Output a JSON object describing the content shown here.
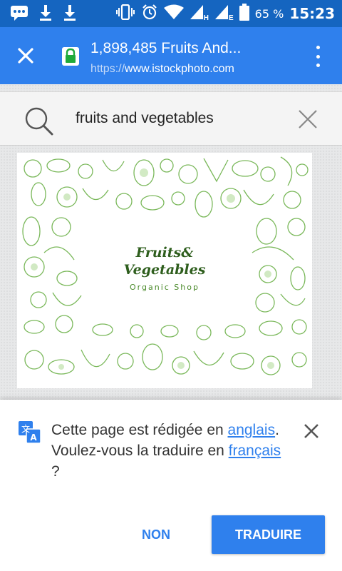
{
  "status_bar": {
    "icons": [
      "message-icon",
      "download-icon",
      "download-icon",
      "vibrate-icon",
      "alarm-icon",
      "wifi-icon",
      "signal-icon",
      "signal-icon",
      "battery-icon"
    ],
    "network_label_1": "H",
    "network_label_2": "E",
    "battery_percent": "65 %",
    "time": "15:23"
  },
  "toolbar": {
    "page_title": "1,898,485 Fruits And...",
    "url_protocol": "https://",
    "url_host": "www.istockphoto.com"
  },
  "search": {
    "query": "fruits and vegetables"
  },
  "image": {
    "logo_line1": "Fruits&",
    "logo_line2": "Vegetables",
    "logo_subtitle": "Organic Shop"
  },
  "translate_bar": {
    "message_part1": "Cette page est rédigée en ",
    "language_source": "anglais",
    "message_part2": ". Voulez-vous la traduire en ",
    "language_target": "français",
    "message_part3": " ?",
    "decline_label": "NON",
    "accept_label": "TRADUIRE"
  },
  "colors": {
    "status_bar": "#1565c0",
    "toolbar": "#2f80ed",
    "accent": "#2f80ed",
    "pattern_green": "#7ab85a"
  }
}
